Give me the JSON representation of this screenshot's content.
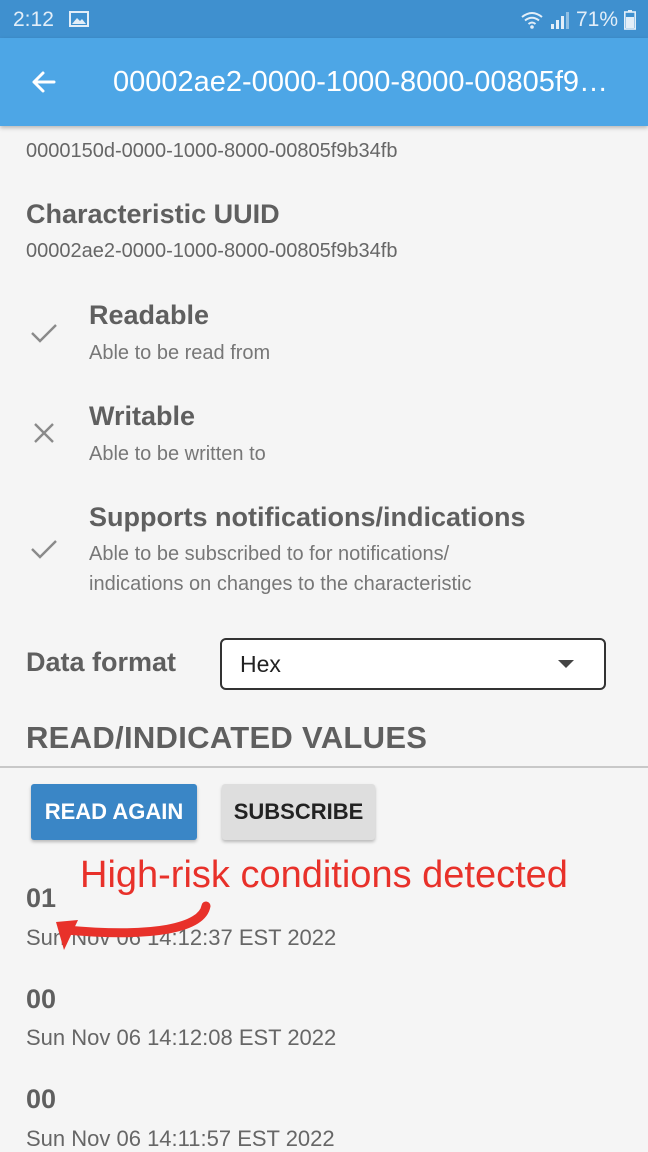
{
  "status_bar": {
    "time": "2:12",
    "battery": "71%",
    "icons": [
      "image-icon",
      "wifi-icon",
      "signal-icon",
      "battery-icon"
    ]
  },
  "app_bar": {
    "title": "00002ae2-0000-1000-8000-00805f9b34fb",
    "back_icon": "arrow-left-icon"
  },
  "service_uuid": "0000150d-0000-1000-8000-00805f9b34fb",
  "characteristic": {
    "label": "Characteristic UUID",
    "uuid": "00002ae2-0000-1000-8000-00805f9b34fb"
  },
  "properties": [
    {
      "title": "Readable",
      "desc": "Able to be read from",
      "icon": "check-icon",
      "supported": true
    },
    {
      "title": "Writable",
      "desc": "Able to be written to",
      "icon": "close-icon",
      "supported": false
    },
    {
      "title": "Supports notifications/indications",
      "desc1": "Able to be subscribed to for notifications/",
      "desc2": "indications on changes to the characteristic",
      "icon": "check-icon",
      "supported": true
    }
  ],
  "data_format": {
    "label": "Data format",
    "selected": "Hex"
  },
  "values_section": {
    "heading": "READ/INDICATED VALUES",
    "read_again_label": "READ AGAIN",
    "subscribe_label": "SUBSCRIBE"
  },
  "readings": [
    {
      "value": "01",
      "time": "Sun Nov 06 14:12:37 EST 2022"
    },
    {
      "value": "00",
      "time": "Sun Nov 06 14:12:08 EST 2022"
    },
    {
      "value": "00",
      "time": "Sun Nov 06 14:11:57 EST 2022"
    }
  ],
  "annotation": {
    "text": "High-risk conditions detected",
    "color": "#e8312a"
  },
  "colors": {
    "app_bar": "#4da6e6",
    "status_bar": "#3f90cf",
    "primary_button": "#3a86c6"
  }
}
